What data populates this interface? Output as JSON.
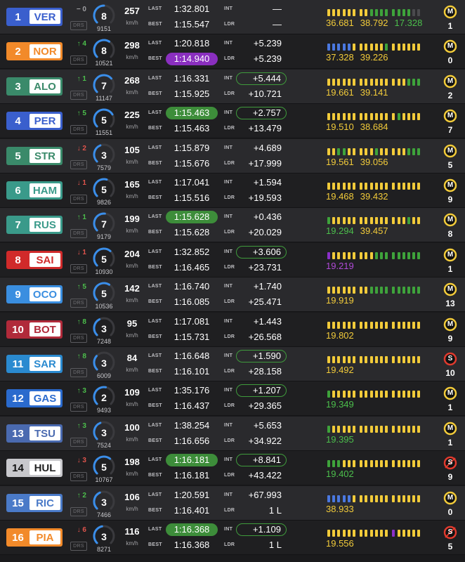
{
  "colors": {
    "row_even": "#2a2a2d",
    "row_odd": "#1f1f21",
    "segment_yellow": "#f2cb3a",
    "segment_green": "#3ea33b",
    "segment_purple": "#8b2fc9",
    "segment_blue": "#4a78e0",
    "segment_grey": "#4a4a4e",
    "gain": "#4cbf4c",
    "loss": "#e0544c",
    "neutral": "#a0a0a4",
    "tyre_medium": "#f2cb3a",
    "tyre_soft": "#e03a2e",
    "gauge_blue": "#3a8eea",
    "gauge_track": "#3a3a3e"
  },
  "labels": {
    "last": "LAST",
    "best": "BEST",
    "int": "INT",
    "ldr": "LDR",
    "kmh": "km/h",
    "drs": "DRS"
  },
  "drivers": [
    {
      "pos": "1",
      "code": "VER",
      "team_color": "#3a5fcd",
      "delta": "− 0",
      "delta_dir": "none",
      "gear": "8",
      "rpm": "9151",
      "rpm_fraction": 0.5,
      "speed": "257",
      "last": "1:32.801",
      "last_style": "",
      "best": "1:15.547",
      "best_style": "",
      "int": "—",
      "int_style": "",
      "ldr": "—",
      "segments": "YYYYYYYYGGGGGGGG",
      "sectors": [
        {
          "v": "36.681",
          "c": "#f2cb3a"
        },
        {
          "v": "38.792",
          "c": "#f2cb3a"
        },
        {
          "v": "17.328",
          "c": "#4cbf4c"
        }
      ],
      "tyre": "M",
      "tyre_variant": "clean",
      "laps": "1"
    },
    {
      "pos": "2",
      "code": "NOR",
      "team_color": "#f28a2a",
      "delta": "↑ 4",
      "delta_dir": "up",
      "gear": "8",
      "rpm": "10521",
      "rpm_fraction": 0.62,
      "speed": "298",
      "last": "1:20.818",
      "last_style": "",
      "best": "1:14.940",
      "best_style": "purple",
      "int": "+5.239",
      "int_style": "",
      "ldr": "+5.239",
      "segments": "BBBBBYYYYYYGYYYYYY",
      "sectors": [
        {
          "v": "37.328",
          "c": "#f2cb3a"
        },
        {
          "v": "39.226",
          "c": "#f2cb3a"
        }
      ],
      "tyre": "M",
      "tyre_variant": "clean",
      "laps": "0"
    },
    {
      "pos": "3",
      "code": "ALO",
      "team_color": "#3a8a6a",
      "delta": "↑ 1",
      "delta_dir": "up",
      "gear": "7",
      "rpm": "11147",
      "rpm_fraction": 0.68,
      "speed": "268",
      "last": "1:16.331",
      "last_style": "",
      "best": "1:15.925",
      "best_style": "",
      "int": "+5.444",
      "int_style": "boxed",
      "ldr": "+10.721",
      "segments": "YYYYYYYYYYYYYYYGGG",
      "sectors": [
        {
          "v": "19.661",
          "c": "#f2cb3a"
        },
        {
          "v": "39.141",
          "c": "#f2cb3a"
        }
      ],
      "tyre": "M",
      "tyre_variant": "clean",
      "laps": "2"
    },
    {
      "pos": "4",
      "code": "PER",
      "team_color": "#3a5fcd",
      "delta": "↑ 5",
      "delta_dir": "up",
      "gear": "5",
      "rpm": "11551",
      "rpm_fraction": 0.72,
      "speed": "225",
      "last": "1:15.463",
      "last_style": "green",
      "best": "1:15.463",
      "best_style": "",
      "int": "+2.757",
      "int_style": "boxed",
      "ldr": "+13.479",
      "segments": "YYYYYYYYYYYYYGYYYY",
      "sectors": [
        {
          "v": "19.510",
          "c": "#f2cb3a"
        },
        {
          "v": "38.684",
          "c": "#f2cb3a"
        }
      ],
      "tyre": "M",
      "tyre_variant": "clean",
      "laps": "7"
    },
    {
      "pos": "5",
      "code": "STR",
      "team_color": "#3a8a6a",
      "delta": "↓ 2",
      "delta_dir": "down",
      "gear": "3",
      "rpm": "7579",
      "rpm_fraction": 0.42,
      "speed": "105",
      "last": "1:15.879",
      "last_style": "",
      "best": "1:15.676",
      "best_style": "",
      "int": "+4.689",
      "int_style": "",
      "ldr": "+17.999",
      "segments": "YYGGYYYYYGYYYYYGGG",
      "sectors": [
        {
          "v": "19.561",
          "c": "#f2cb3a"
        },
        {
          "v": "39.056",
          "c": "#f2cb3a"
        }
      ],
      "tyre": "M",
      "tyre_variant": "clean",
      "laps": "5"
    },
    {
      "pos": "6",
      "code": "HAM",
      "team_color": "#3a9a8a",
      "delta": "↓ 1",
      "delta_dir": "down",
      "gear": "5",
      "rpm": "9826",
      "rpm_fraction": 0.56,
      "speed": "165",
      "last": "1:17.041",
      "last_style": "",
      "best": "1:15.516",
      "best_style": "",
      "int": "+1.594",
      "int_style": "",
      "ldr": "+19.593",
      "segments": "YYYYYYYYYYYYYYYYYY",
      "sectors": [
        {
          "v": "19.468",
          "c": "#f2cb3a"
        },
        {
          "v": "39.432",
          "c": "#f2cb3a"
        }
      ],
      "tyre": "M",
      "tyre_variant": "clean",
      "laps": "9"
    },
    {
      "pos": "7",
      "code": "RUS",
      "team_color": "#3a9a8a",
      "delta": "↑ 1",
      "delta_dir": "up",
      "gear": "7",
      "rpm": "9179",
      "rpm_fraction": 0.52,
      "speed": "199",
      "last": "1:15.628",
      "last_style": "green",
      "best": "1:15.628",
      "best_style": "",
      "int": "+0.436",
      "int_style": "",
      "ldr": "+20.029",
      "segments": "GYYYYYYYYYYYYYYGYY",
      "sectors": [
        {
          "v": "19.294",
          "c": "#4cbf4c"
        },
        {
          "v": "39.457",
          "c": "#f2cb3a"
        }
      ],
      "tyre": "M",
      "tyre_variant": "clean",
      "laps": "8"
    },
    {
      "pos": "8",
      "code": "SAI",
      "team_color": "#d02a2a",
      "delta": "↓ 1",
      "delta_dir": "down",
      "gear": "5",
      "rpm": "10930",
      "rpm_fraction": 0.65,
      "speed": "204",
      "last": "1:32.852",
      "last_style": "",
      "best": "1:16.465",
      "best_style": "",
      "int": "+3.606",
      "int_style": "boxed",
      "ldr": "+23.731",
      "segments": "PYYYYYYYYGGGGGGGGG",
      "sectors": [
        {
          "v": "19.219",
          "c": "#b04ad8"
        }
      ],
      "tyre": "M",
      "tyre_variant": "clean",
      "laps": "1"
    },
    {
      "pos": "9",
      "code": "OCO",
      "team_color": "#3a8ee0",
      "delta": "↑ 5",
      "delta_dir": "up",
      "gear": "5",
      "rpm": "10536",
      "rpm_fraction": 0.62,
      "speed": "142",
      "last": "1:16.740",
      "last_style": "",
      "best": "1:16.085",
      "best_style": "",
      "int": "+1.740",
      "int_style": "",
      "ldr": "+25.471",
      "segments": "YYYYYYYYGGGGGGGGGG",
      "sectors": [
        {
          "v": "19.919",
          "c": "#f2cb3a"
        }
      ],
      "tyre": "M",
      "tyre_variant": "clean",
      "laps": "13"
    },
    {
      "pos": "10",
      "code": "BOT",
      "team_color": "#b02a3a",
      "delta": "↑ 8",
      "delta_dir": "up",
      "gear": "3",
      "rpm": "7248",
      "rpm_fraction": 0.4,
      "speed": "95",
      "last": "1:17.081",
      "last_style": "",
      "best": "1:15.731",
      "best_style": "",
      "int": "+1.443",
      "int_style": "",
      "ldr": "+26.568",
      "segments": "YYYYYYYYYYYYYYYYYY",
      "sectors": [
        {
          "v": "19.802",
          "c": "#f2cb3a"
        }
      ],
      "tyre": "M",
      "tyre_variant": "clean",
      "laps": "9"
    },
    {
      "pos": "11",
      "code": "SAR",
      "team_color": "#2a8ad0",
      "delta": "↑ 8",
      "delta_dir": "up",
      "gear": "3",
      "rpm": "6009",
      "rpm_fraction": 0.32,
      "speed": "84",
      "last": "1:16.648",
      "last_style": "",
      "best": "1:16.101",
      "best_style": "",
      "int": "+1.590",
      "int_style": "boxed",
      "ldr": "+28.158",
      "segments": "YYYYYYYYYYYYYYYYYY",
      "sectors": [
        {
          "v": "19.492",
          "c": "#f2cb3a"
        }
      ],
      "tyre": "S",
      "tyre_variant": "clean",
      "laps": "10"
    },
    {
      "pos": "12",
      "code": "GAS",
      "team_color": "#2a6acd",
      "delta": "↑ 3",
      "delta_dir": "up",
      "gear": "2",
      "rpm": "9493",
      "rpm_fraction": 0.54,
      "speed": "109",
      "last": "1:35.176",
      "last_style": "",
      "best": "1:16.437",
      "best_style": "",
      "int": "+1.207",
      "int_style": "boxed",
      "ldr": "+29.365",
      "segments": "GYYYYYYYYYYYYYYYYY",
      "sectors": [
        {
          "v": "19.349",
          "c": "#4cbf4c"
        }
      ],
      "tyre": "M",
      "tyre_variant": "clean",
      "laps": "1"
    },
    {
      "pos": "13",
      "code": "TSU",
      "team_color": "#4a6ab0",
      "delta": "↑ 3",
      "delta_dir": "up",
      "gear": "3",
      "rpm": "7524",
      "rpm_fraction": 0.42,
      "speed": "100",
      "last": "1:38.254",
      "last_style": "",
      "best": "1:16.656",
      "best_style": "",
      "int": "+5.653",
      "int_style": "",
      "ldr": "+34.922",
      "segments": "GYYYYYYYYYYYYYYYYY",
      "sectors": [
        {
          "v": "19.395",
          "c": "#4cbf4c"
        }
      ],
      "tyre": "M",
      "tyre_variant": "clean",
      "laps": "1"
    },
    {
      "pos": "14",
      "code": "HUL",
      "team_color": "#c8c8cc",
      "pos_text_color": "#111",
      "delta": "↓ 3",
      "delta_dir": "down",
      "gear": "5",
      "rpm": "10767",
      "rpm_fraction": 0.64,
      "speed": "198",
      "last": "1:16.181",
      "last_style": "green",
      "best": "1:16.181",
      "best_style": "",
      "int": "+8.841",
      "int_style": "boxed",
      "ldr": "+43.422",
      "segments": "GGGYYYYYYYYYYYYYYY",
      "sectors": [
        {
          "v": "19.402",
          "c": "#4cbf4c"
        }
      ],
      "tyre": "S",
      "tyre_variant": "used",
      "laps": "9"
    },
    {
      "pos": "15",
      "code": "RIC",
      "team_color": "#4a7ac8",
      "delta": "↑ 2",
      "delta_dir": "up",
      "gear": "3",
      "rpm": "7466",
      "rpm_fraction": 0.41,
      "speed": "106",
      "last": "1:20.591",
      "last_style": "",
      "best": "1:16.401",
      "best_style": "",
      "int": "+67.993",
      "int_style": "",
      "ldr": "1 L",
      "segments": "BBBBBYYYYYYYYYYYYY",
      "sectors": [
        {
          "v": "38.933",
          "c": "#f2cb3a"
        }
      ],
      "tyre": "M",
      "tyre_variant": "clean",
      "laps": "0"
    },
    {
      "pos": "16",
      "code": "PIA",
      "team_color": "#f28a2a",
      "delta": "↓ 6",
      "delta_dir": "down",
      "gear": "3",
      "rpm": "8271",
      "rpm_fraction": 0.46,
      "speed": "116",
      "last": "1:16.368",
      "last_style": "green",
      "best": "1:16.368",
      "best_style": "",
      "int": "+1.109",
      "int_style": "boxed",
      "ldr": "1 L",
      "segments": "YYYYYYYYYYYYPYYYYY",
      "sectors": [
        {
          "v": "19.556",
          "c": "#f2cb3a"
        }
      ],
      "tyre": "S",
      "tyre_variant": "used",
      "laps": "5"
    }
  ]
}
